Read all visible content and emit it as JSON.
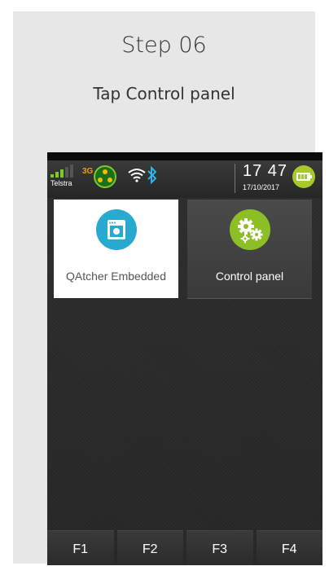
{
  "step": {
    "title": "Step 06",
    "instruction": "Tap Control panel"
  },
  "statusbar": {
    "carrier": "Telstra",
    "network_type": "3G",
    "time": "17 47",
    "date": "17/10/2017",
    "icons": [
      "signal-icon",
      "network-icon",
      "wifi-icon",
      "bluetooth-icon",
      "battery-icon"
    ]
  },
  "apps": [
    {
      "label": "QAtcher Embedded",
      "icon": "window-app-icon",
      "accent": "#29a9d0"
    },
    {
      "label": "Control panel",
      "icon": "gears-icon",
      "accent": "#8cbf26"
    }
  ],
  "fkeys": [
    "F1",
    "F2",
    "F3",
    "F4"
  ],
  "colors": {
    "card_bg": "#e7e7e7",
    "screen_bg": "#2b2b2b",
    "network_type": "#f0a000",
    "battery": "#a8c92a"
  }
}
